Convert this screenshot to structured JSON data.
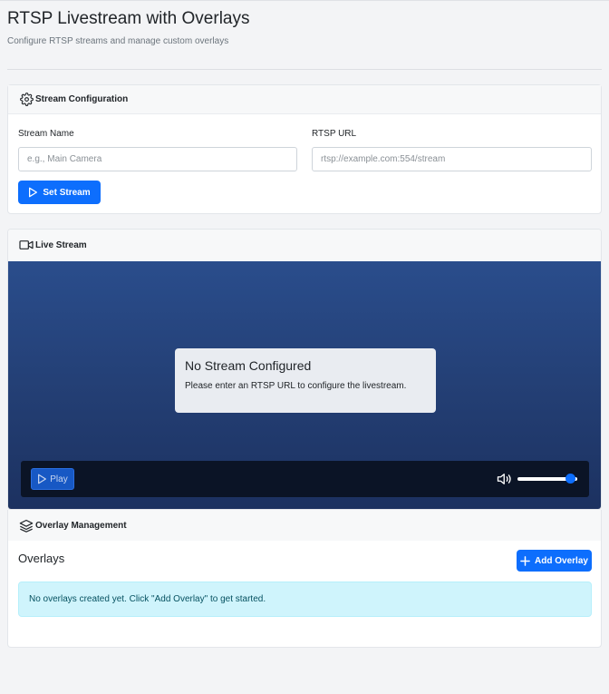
{
  "header": {
    "title": "RTSP Livestream with Overlays",
    "subtitle": "Configure RTSP streams and manage custom overlays"
  },
  "config": {
    "heading": "Stream Configuration",
    "heading_icon": "gear-icon",
    "stream_name_label": "Stream Name",
    "stream_name_value": "",
    "stream_name_placeholder": "e.g., Main Camera",
    "rtsp_url_label": "RTSP URL",
    "rtsp_url_value": "",
    "rtsp_url_placeholder": "rtsp://example.com:554/stream",
    "set_stream_label": "Set Stream"
  },
  "live": {
    "heading": "Live Stream",
    "heading_icon": "video-camera-icon",
    "no_stream_title": "No Stream Configured",
    "no_stream_text": "Please enter an RTSP URL to configure the livestream.",
    "play_label": "Play",
    "volume_level": 0.88
  },
  "overlay": {
    "heading": "Overlay Management",
    "heading_icon": "layers-icon",
    "title": "Overlays",
    "add_label": "Add Overlay",
    "empty_message": "No overlays created yet. Click \"Add Overlay\" to get started."
  },
  "colors": {
    "primary": "#0d6efd",
    "alert_bg": "#cff4fc",
    "alert_text": "#055160",
    "video_bg": "#233e73"
  }
}
